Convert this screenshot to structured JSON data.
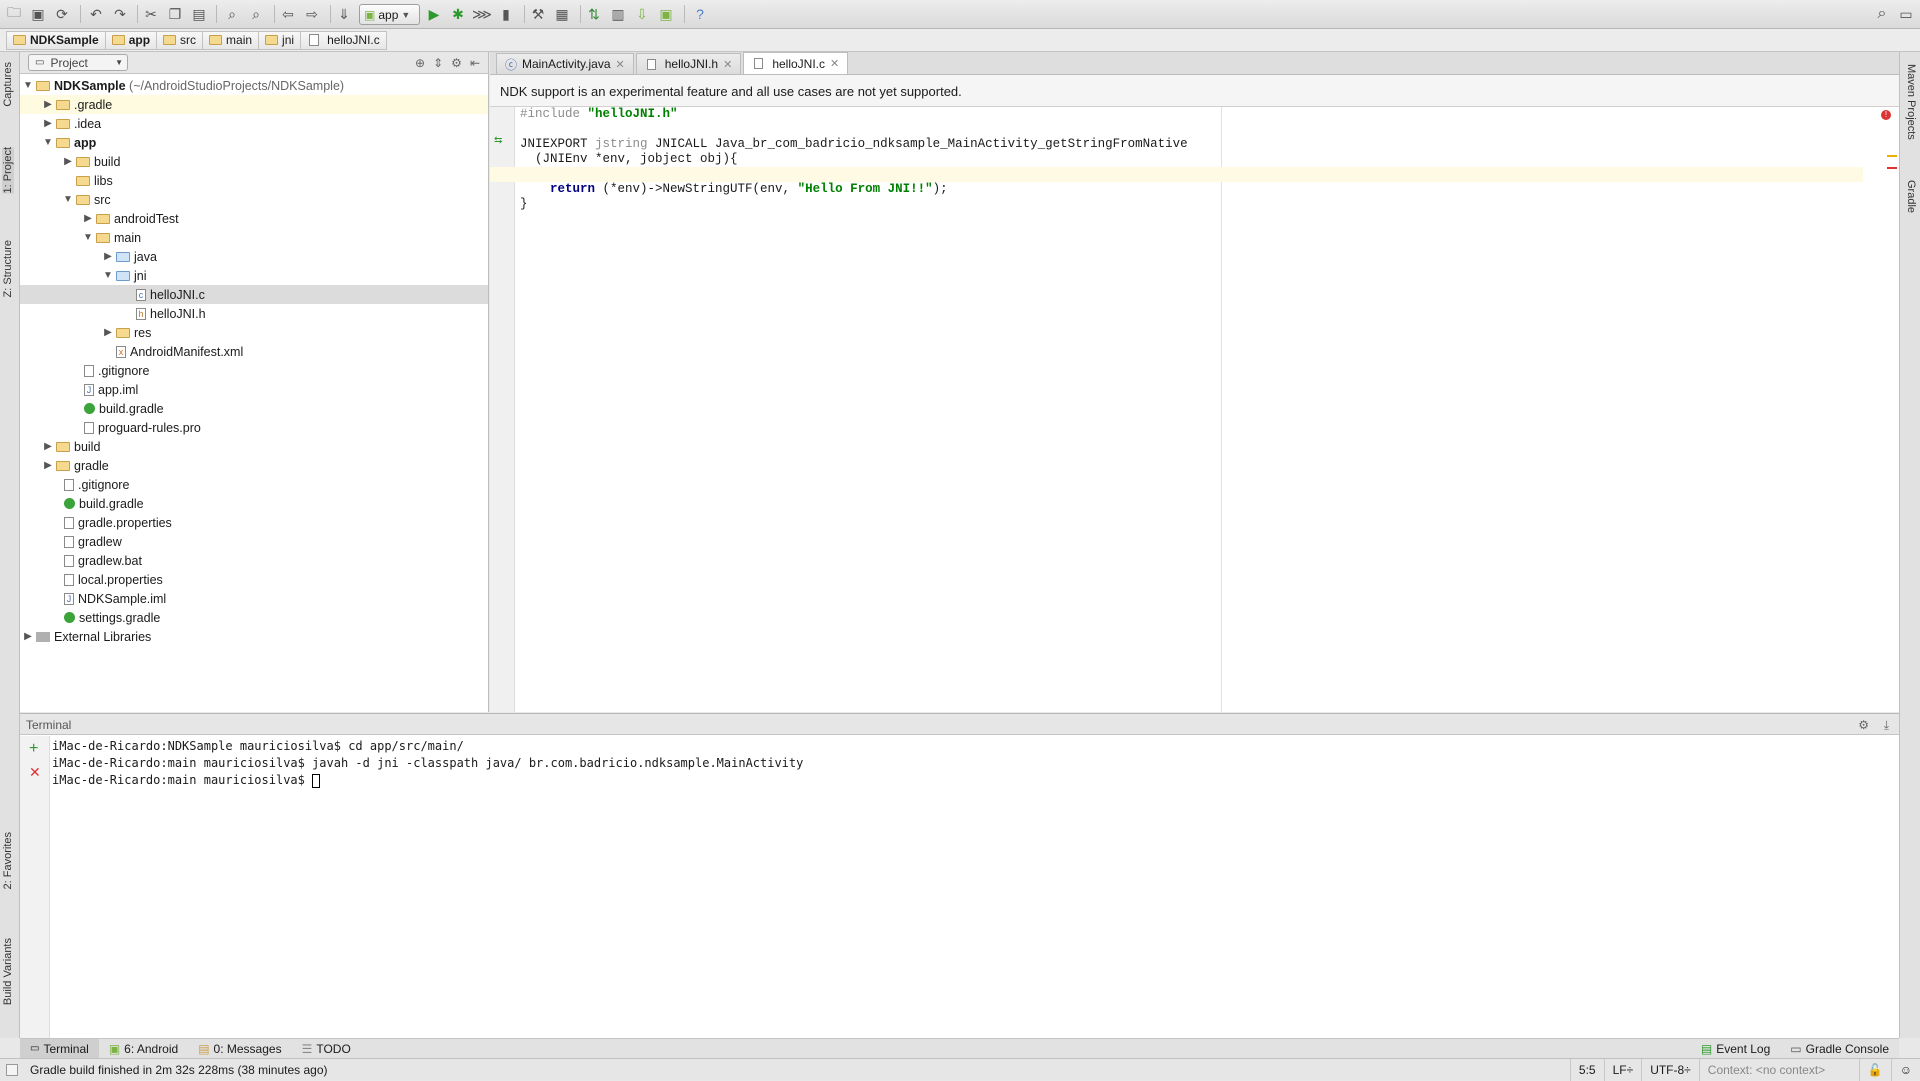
{
  "toolbar": {
    "run_config": "app"
  },
  "breadcrumbs": [
    "NDKSample",
    "app",
    "src",
    "main",
    "jni",
    "helloJNI.c"
  ],
  "left_strip": {
    "captures": "Captures",
    "project": "1: Project",
    "structure": "Z: Structure",
    "favorites": "2: Favorites",
    "build_variants": "Build Variants"
  },
  "right_strip": {
    "maven": "Maven Projects",
    "gradle": "Gradle"
  },
  "project": {
    "view": "Project",
    "root": {
      "name": "NDKSample",
      "path": "(~/AndroidStudioProjects/NDKSample)"
    },
    "items": [
      ".gradle",
      ".idea",
      "app",
      "build",
      "libs",
      "src",
      "androidTest",
      "main",
      "java",
      "jni",
      "helloJNI.c",
      "helloJNI.h",
      "res",
      "AndroidManifest.xml",
      ".gitignore",
      "app.iml",
      "build.gradle",
      "proguard-rules.pro",
      "build",
      "gradle",
      ".gitignore",
      "build.gradle",
      "gradle.properties",
      "gradlew",
      "gradlew.bat",
      "local.properties",
      "NDKSample.iml",
      "settings.gradle",
      "External Libraries"
    ]
  },
  "editor": {
    "tabs": [
      "MainActivity.java",
      "helloJNI.h",
      "helloJNI.c"
    ],
    "notice": "NDK support is an experimental feature and all use cases are not yet supported.",
    "code": {
      "include": "#include ",
      "include_file": "\"helloJNI.h\"",
      "sig1a": "JNIEXPORT ",
      "sig1b": "jstring",
      "sig1c": " JNICALL Java_br_com_badricio_ndksample_MainActivity_getStringFromNative",
      "sig2": "  (JNIEnv *env, jobject obj){",
      "ret_kw": "return",
      "ret_a": " (*env)->NewStringUTF(env, ",
      "ret_str": "\"Hello From JNI!!\"",
      "ret_b": ");",
      "close": "}"
    }
  },
  "terminal": {
    "title": "Terminal",
    "lines": [
      "iMac-de-Ricardo:NDKSample mauriciosilva$ cd app/src/main/",
      "iMac-de-Ricardo:main mauriciosilva$ javah -d jni -classpath java/ br.com.badricio.ndksample.MainActivity",
      "iMac-de-Ricardo:main mauriciosilva$ "
    ]
  },
  "bottom_tabs": {
    "terminal": "Terminal",
    "android": "6: Android",
    "messages": "0: Messages",
    "todo": "TODO",
    "event_log": "Event Log",
    "gradle_console": "Gradle Console"
  },
  "status": {
    "message": "Gradle build finished in 2m 32s 228ms (38 minutes ago)",
    "position": "5:5",
    "line_sep": "LF÷",
    "encoding": "UTF-8÷",
    "context": "Context: <no context>"
  }
}
